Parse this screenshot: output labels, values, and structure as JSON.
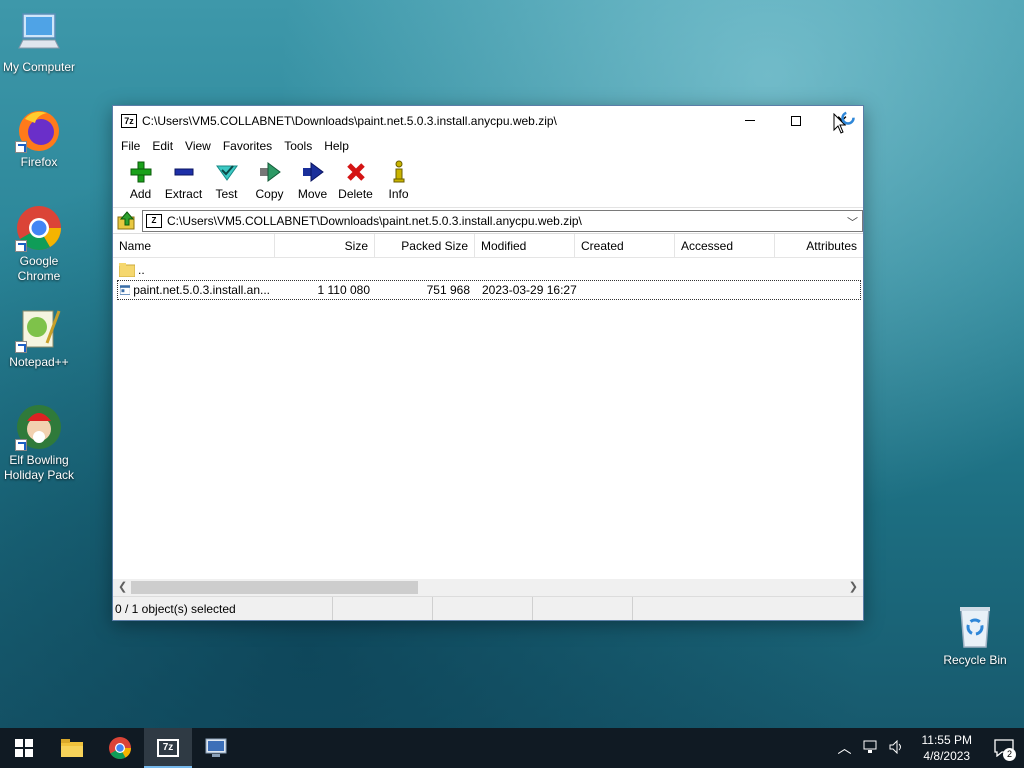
{
  "desktop": {
    "icons": [
      {
        "label": "My Computer"
      },
      {
        "label": "Firefox"
      },
      {
        "label": "Google Chrome"
      },
      {
        "label": "Notepad++"
      },
      {
        "label": "Elf Bowling Holiday Pack"
      },
      {
        "label": "Recycle Bin"
      }
    ]
  },
  "window": {
    "app_icon": "7z",
    "title": "C:\\Users\\VM5.COLLABNET\\Downloads\\paint.net.5.0.3.install.anycpu.web.zip\\",
    "menu": [
      "File",
      "Edit",
      "View",
      "Favorites",
      "Tools",
      "Help"
    ],
    "toolbar": [
      {
        "label": "Add",
        "icon": "plus-icon",
        "color": "#1aa11a"
      },
      {
        "label": "Extract",
        "icon": "minus-icon",
        "color": "#1d2fa8"
      },
      {
        "label": "Test",
        "icon": "check-arrow-icon",
        "color": "#3cc9c4"
      },
      {
        "label": "Copy",
        "icon": "double-arrow-icon",
        "color": "#2e9a66"
      },
      {
        "label": "Move",
        "icon": "arrow-right-icon",
        "color": "#1a2f9a"
      },
      {
        "label": "Delete",
        "icon": "x-icon",
        "color": "#d41414"
      },
      {
        "label": "Info",
        "icon": "info-icon",
        "color": "#c9b400"
      }
    ],
    "address": {
      "value": "C:\\Users\\VM5.COLLABNET\\Downloads\\paint.net.5.0.3.install.anycpu.web.zip\\"
    },
    "columns": [
      "Name",
      "Size",
      "Packed Size",
      "Modified",
      "Created",
      "Accessed",
      "Attributes"
    ],
    "rows": [
      {
        "name": "..",
        "size": "",
        "packed": "",
        "modified": "",
        "type": "folder"
      },
      {
        "name": "paint.net.5.0.3.install.an...",
        "size": "1 110 080",
        "packed": "751 968",
        "modified": "2023-03-29 16:27",
        "type": "exe"
      }
    ],
    "status": "0 / 1 object(s) selected"
  },
  "taskbar": {
    "time": "11:55 PM",
    "date": "4/8/2023",
    "notification_count": "2",
    "active_app_label": "7z"
  }
}
